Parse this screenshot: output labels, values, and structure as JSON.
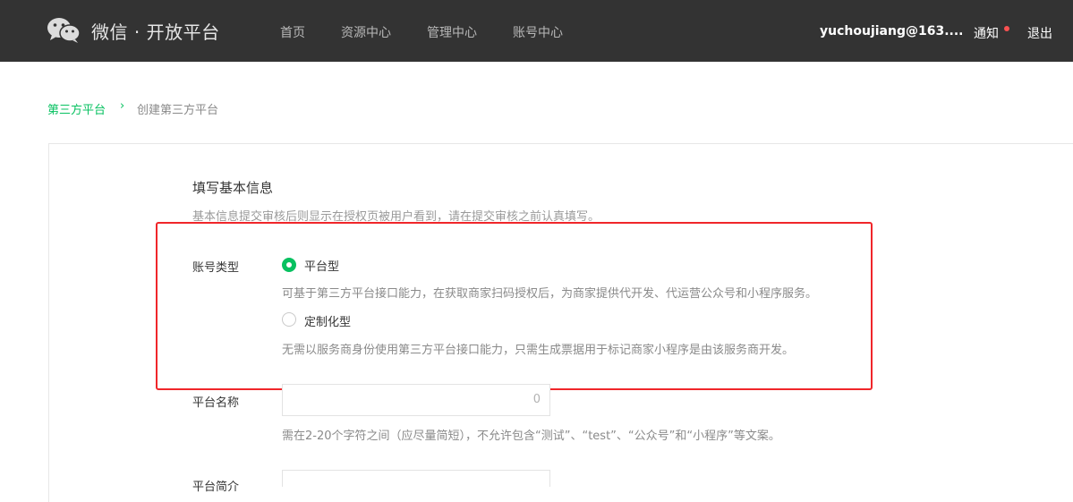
{
  "header": {
    "brand": "微信 · 开放平台",
    "nav": [
      "首页",
      "资源中心",
      "管理中心",
      "账号中心"
    ],
    "user": "yuchoujiang@163....",
    "notify_label": "通知",
    "logout_label": "退出"
  },
  "breadcrumb": {
    "root": "第三方平台",
    "separator": "›",
    "current": "创建第三方平台"
  },
  "section": {
    "title": "填写基本信息",
    "description": "基本信息提交审核后则显示在授权页被用户看到，请在提交审核之前认真填写。"
  },
  "account_type": {
    "label": "账号类型",
    "options": [
      {
        "label": "平台型",
        "checked": true,
        "description": "可基于第三方平台接口能力，在获取商家扫码授权后，为商家提供代开发、代运营公众号和小程序服务。"
      },
      {
        "label": "定制化型",
        "checked": false,
        "description": "无需以服务商身份使用第三方平台接口能力，只需生成票据用于标记商家小程序是由该服务商开发。"
      }
    ]
  },
  "platform_name": {
    "label": "平台名称",
    "counter": "0",
    "hint": "需在2-20个字符之间（应尽量简短），不允许包含“测试”、“test”、“公众号”和“小程序”等文案。"
  },
  "platform_intro": {
    "label": "平台简介"
  },
  "colors": {
    "accent": "#07c160",
    "topbar": "#333333",
    "highlight": "#f0262a",
    "notify_dot": "#fa5151"
  }
}
